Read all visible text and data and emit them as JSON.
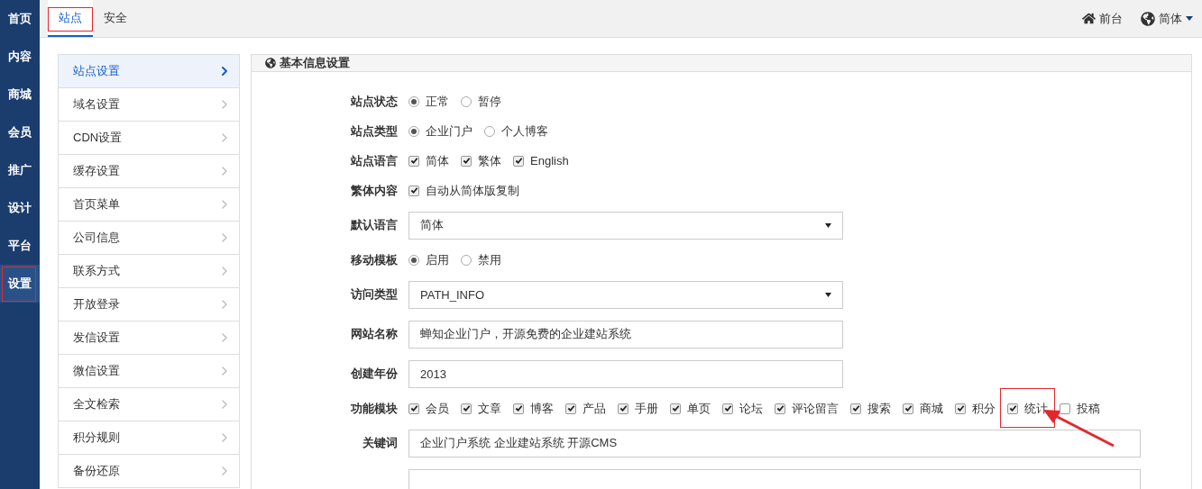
{
  "sidebar": {
    "items": [
      {
        "label": "首页",
        "selected": false,
        "highlighted": false
      },
      {
        "label": "内容",
        "selected": false,
        "highlighted": false
      },
      {
        "label": "商城",
        "selected": false,
        "highlighted": false
      },
      {
        "label": "会员",
        "selected": false,
        "highlighted": false
      },
      {
        "label": "推广",
        "selected": false,
        "highlighted": false
      },
      {
        "label": "设计",
        "selected": false,
        "highlighted": false
      },
      {
        "label": "平台",
        "selected": false,
        "highlighted": false
      },
      {
        "label": "设置",
        "selected": true,
        "highlighted": true
      }
    ]
  },
  "tabs": [
    {
      "label": "站点",
      "selected": true,
      "highlighted": true
    },
    {
      "label": "安全",
      "selected": false,
      "highlighted": false
    }
  ],
  "top_links": {
    "frontend": "前台",
    "language": "简体"
  },
  "menu": {
    "items": [
      {
        "label": "站点设置",
        "selected": true
      },
      {
        "label": "域名设置",
        "selected": false
      },
      {
        "label": "CDN设置",
        "selected": false
      },
      {
        "label": "缓存设置",
        "selected": false
      },
      {
        "label": "首页菜单",
        "selected": false
      },
      {
        "label": "公司信息",
        "selected": false
      },
      {
        "label": "联系方式",
        "selected": false
      },
      {
        "label": "开放登录",
        "selected": false
      },
      {
        "label": "发信设置",
        "selected": false
      },
      {
        "label": "微信设置",
        "selected": false
      },
      {
        "label": "全文检索",
        "selected": false
      },
      {
        "label": "积分规则",
        "selected": false
      },
      {
        "label": "备份还原",
        "selected": false
      }
    ]
  },
  "panel": {
    "title": "基本信息设置",
    "rows": [
      {
        "label": "站点状态",
        "kind": "radio",
        "options": [
          {
            "label": "正常",
            "selected": true
          },
          {
            "label": "暂停",
            "selected": false
          }
        ]
      },
      {
        "label": "站点类型",
        "kind": "radio",
        "options": [
          {
            "label": "企业门户",
            "selected": true
          },
          {
            "label": "个人博客",
            "selected": false
          }
        ]
      },
      {
        "label": "站点语言",
        "kind": "checkbox",
        "options": [
          {
            "label": "简体",
            "checked": true,
            "highlighted": false
          },
          {
            "label": "繁体",
            "checked": true,
            "highlighted": false
          },
          {
            "label": "English",
            "checked": true,
            "highlighted": false
          }
        ]
      },
      {
        "label": "繁体内容",
        "kind": "checkbox",
        "options": [
          {
            "label": "自动从简体版复制",
            "checked": true,
            "highlighted": false
          }
        ]
      },
      {
        "label": "默认语言",
        "kind": "select",
        "value": "简体"
      },
      {
        "label": "移动模板",
        "kind": "radio",
        "options": [
          {
            "label": "启用",
            "selected": true
          },
          {
            "label": "禁用",
            "selected": false
          }
        ]
      },
      {
        "label": "访问类型",
        "kind": "select",
        "value": "PATH_INFO"
      },
      {
        "label": "网站名称",
        "kind": "input",
        "value": "蝉知企业门户，开源免费的企业建站系统"
      },
      {
        "label": "创建年份",
        "kind": "input",
        "value": "2013"
      },
      {
        "label": "功能模块",
        "kind": "checkbox",
        "options": [
          {
            "label": "会员",
            "checked": true,
            "highlighted": false
          },
          {
            "label": "文章",
            "checked": true,
            "highlighted": false
          },
          {
            "label": "博客",
            "checked": true,
            "highlighted": false
          },
          {
            "label": "产品",
            "checked": true,
            "highlighted": false
          },
          {
            "label": "手册",
            "checked": true,
            "highlighted": false
          },
          {
            "label": "单页",
            "checked": true,
            "highlighted": false
          },
          {
            "label": "论坛",
            "checked": true,
            "highlighted": false
          },
          {
            "label": "评论留言",
            "checked": true,
            "highlighted": false
          },
          {
            "label": "搜索",
            "checked": true,
            "highlighted": false
          },
          {
            "label": "商城",
            "checked": true,
            "highlighted": false
          },
          {
            "label": "积分",
            "checked": true,
            "highlighted": false
          },
          {
            "label": "统计",
            "checked": true,
            "highlighted": true
          },
          {
            "label": "投稿",
            "checked": false,
            "highlighted": false
          }
        ]
      },
      {
        "label": "关键词",
        "kind": "input",
        "value": "企业门户系统 企业建站系统 开源CMS",
        "wide": true
      },
      {
        "kind": "input",
        "wide": true
      }
    ]
  }
}
